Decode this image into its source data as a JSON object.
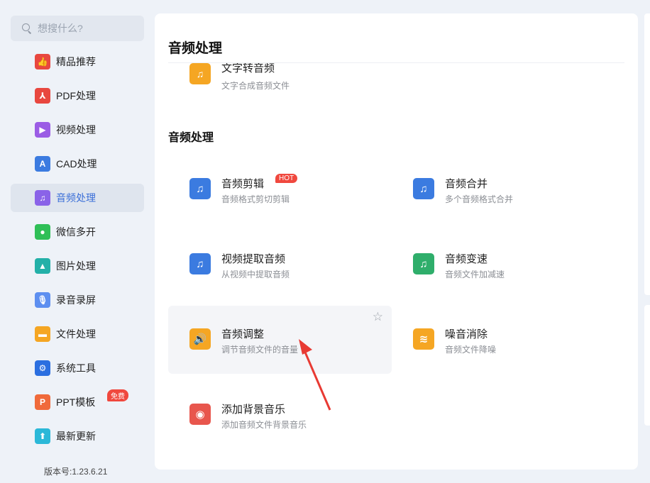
{
  "search": {
    "placeholder": "想搜什么?"
  },
  "sidebar": {
    "items": [
      {
        "label": "精品推荐",
        "icon": "thumbs-up-icon",
        "color": "#e8473f"
      },
      {
        "label": "PDF处理",
        "icon": "pdf-icon",
        "color": "#e8473f"
      },
      {
        "label": "视频处理",
        "icon": "play-icon",
        "color": "#9b5de5"
      },
      {
        "label": "CAD处理",
        "icon": "cad-icon",
        "color": "#3b7be0"
      },
      {
        "label": "音频处理",
        "icon": "music-note-icon",
        "color": "#8a63e8"
      },
      {
        "label": "微信多开",
        "icon": "wechat-icon",
        "color": "#2fbf57"
      },
      {
        "label": "图片处理",
        "icon": "image-icon",
        "color": "#23b0a8"
      },
      {
        "label": "录音录屏",
        "icon": "microphone-icon",
        "color": "#5d8ff0"
      },
      {
        "label": "文件处理",
        "icon": "folder-icon",
        "color": "#f5a623"
      },
      {
        "label": "系统工具",
        "icon": "gear-icon",
        "color": "#2b6fe0"
      },
      {
        "label": "PPT模板",
        "icon": "ppt-icon",
        "color": "#f06a3b"
      },
      {
        "label": "最新更新",
        "icon": "upload-icon",
        "color": "#2bb8d8"
      }
    ],
    "free_badge": "免费",
    "version": "版本号:1.23.6.21"
  },
  "main": {
    "title": "音频处理",
    "partial_card": {
      "title": "文字转音频",
      "desc": "文字合成音频文件"
    },
    "section_title": "音频处理",
    "hot_badge": "HOT",
    "cards": [
      {
        "title": "音频剪辑",
        "desc": "音频格式剪切剪辑",
        "icon": "audio-cut-icon",
        "color": "#3b7be0"
      },
      {
        "title": "音频合并",
        "desc": "多个音频格式合并",
        "icon": "audio-merge-icon",
        "color": "#3b7be0"
      },
      {
        "title": "视频提取音频",
        "desc": "从视频中提取音频",
        "icon": "audio-extract-icon",
        "color": "#3b7be0"
      },
      {
        "title": "音频变速",
        "desc": "音频文件加减速",
        "icon": "audio-speed-icon",
        "color": "#2fae6b"
      },
      {
        "title": "音频调整",
        "desc": "调节音频文件的音量",
        "icon": "volume-icon",
        "color": "#f5a623"
      },
      {
        "title": "噪音消除",
        "desc": "音频文件降噪",
        "icon": "noise-reduce-icon",
        "color": "#f5a623"
      },
      {
        "title": "添加背景音乐",
        "desc": "添加音频文件背景音乐",
        "icon": "background-music-icon",
        "color": "#e8564d"
      }
    ]
  }
}
